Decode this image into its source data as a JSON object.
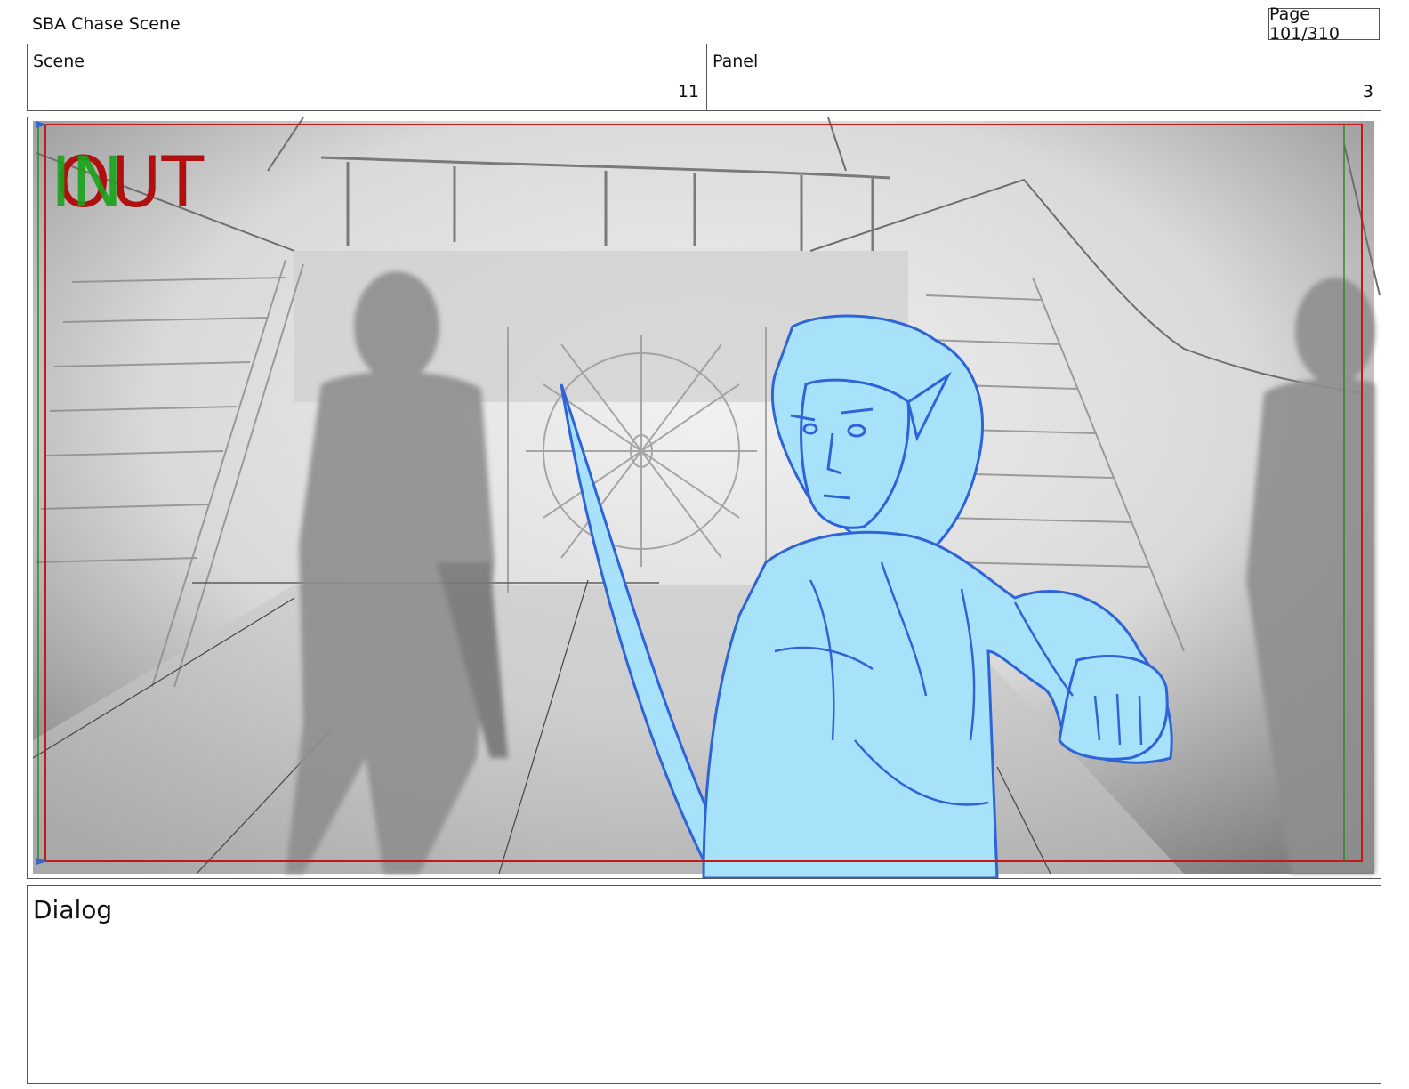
{
  "header": {
    "document_title": "SBA Chase Scene",
    "page_indicator": "Page 101/310"
  },
  "info": {
    "scene_label": "Scene",
    "scene_value": "11",
    "panel_label": "Panel",
    "panel_value": "3"
  },
  "frame": {
    "in_marker": "IN",
    "out_marker": "OUT",
    "colors": {
      "in_marker": "#19a319",
      "out_marker": "#b01010",
      "safe_frame": "#c21a1a",
      "character_fill": "#a8e2fa",
      "character_line": "#2f64d8"
    }
  },
  "dialog": {
    "label": "Dialog"
  }
}
